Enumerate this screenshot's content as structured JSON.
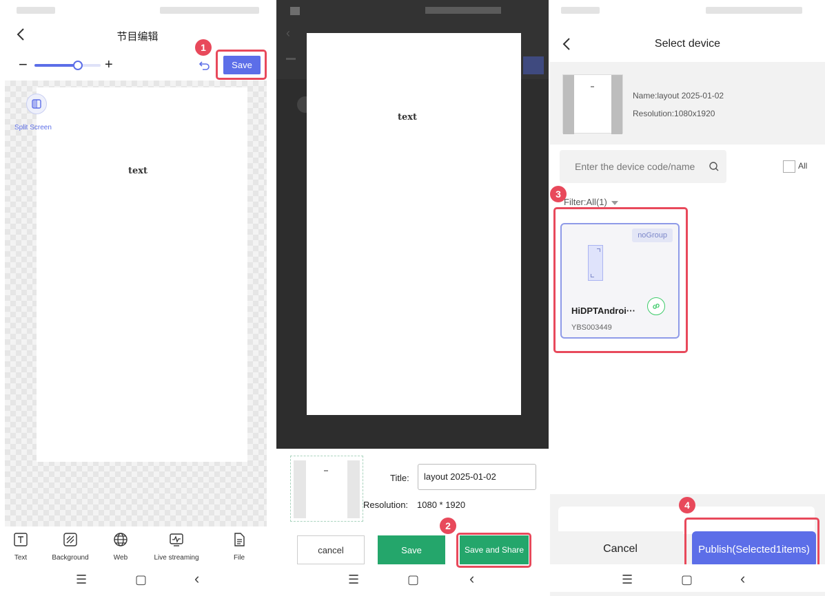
{
  "colors": {
    "accent": "#5c6ee8",
    "highlight": "#e8495b",
    "green": "#24a66b",
    "link_green": "#3ecb6a"
  },
  "panel1": {
    "title": "节目编辑",
    "save_label": "Save",
    "badge": "1",
    "split_screen_label": "Split Screen",
    "canvas_text": "text",
    "zoom_minus": "−",
    "zoom_plus": "+",
    "toolbar": [
      {
        "label": "Text",
        "icon": "text-icon"
      },
      {
        "label": "Background",
        "icon": "background-icon"
      },
      {
        "label": "Web",
        "icon": "globe-icon"
      },
      {
        "label": "Live streaming",
        "icon": "live-streaming-icon"
      },
      {
        "label": "File",
        "icon": "file-icon"
      }
    ]
  },
  "panel2": {
    "canvas_text": "text",
    "title_label": "Title:",
    "title_value": "layout 2025-01-02",
    "resolution_label": "Resolution:",
    "resolution_value": "1080 * 1920",
    "cancel_label": "cancel",
    "save_label": "Save",
    "save_share_label": "Save and Share",
    "badge": "2"
  },
  "panel3": {
    "title": "Select device",
    "name_text": "Name:layout 2025-01-02",
    "resolution_text": "Resolution:1080x1920",
    "search_placeholder": "Enter the device code/name",
    "all_label": "All",
    "filter_text": "Filter:All(1)",
    "badge3": "3",
    "device": {
      "group": "noGroup",
      "name": "HiDPTAndroi···",
      "code": "YBS003449"
    },
    "cancel_label": "Cancel",
    "publish_label": "Publish(Selected1items)",
    "badge4": "4"
  },
  "nav": {
    "menu": "☰",
    "home": "▢",
    "back": "‹"
  }
}
